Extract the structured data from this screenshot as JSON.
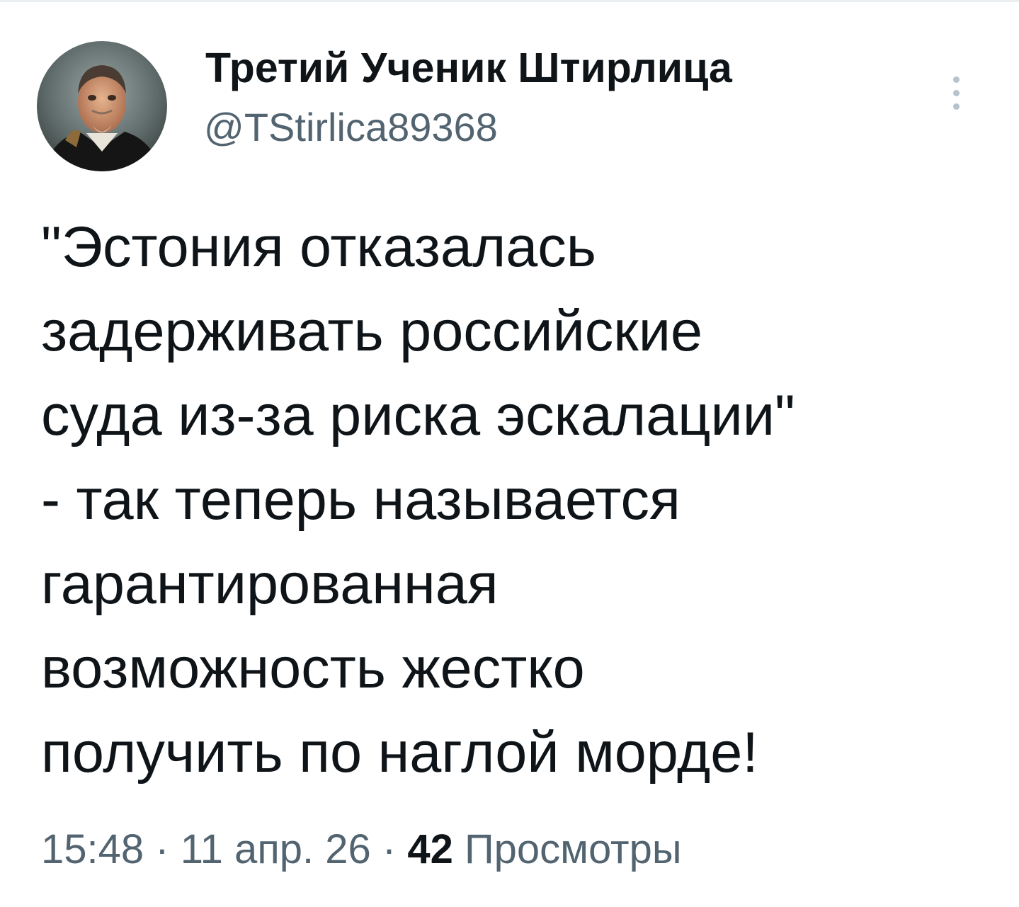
{
  "tweet": {
    "author": {
      "display_name": "Третий Ученик Штирлица",
      "handle": "@TStirlica89368",
      "avatar_icon": "portrait-avatar"
    },
    "more_icon": "vertical-dots-icon",
    "text_lines": [
      "\"Эстония отказалась",
      "задерживать российские",
      "суда из-за риска эскалации\"",
      "- так теперь называется",
      "гарантированная",
      "возможность жестко",
      "получить по наглой морде!"
    ],
    "meta": {
      "time": "15:48",
      "separator": "·",
      "date": "11 апр. 26",
      "views_count": "42",
      "views_label": "Просмотры"
    }
  },
  "colors": {
    "text_primary": "#0f1419",
    "text_secondary": "#536471",
    "more_dots": "#b8c2cb",
    "background": "#ffffff"
  }
}
